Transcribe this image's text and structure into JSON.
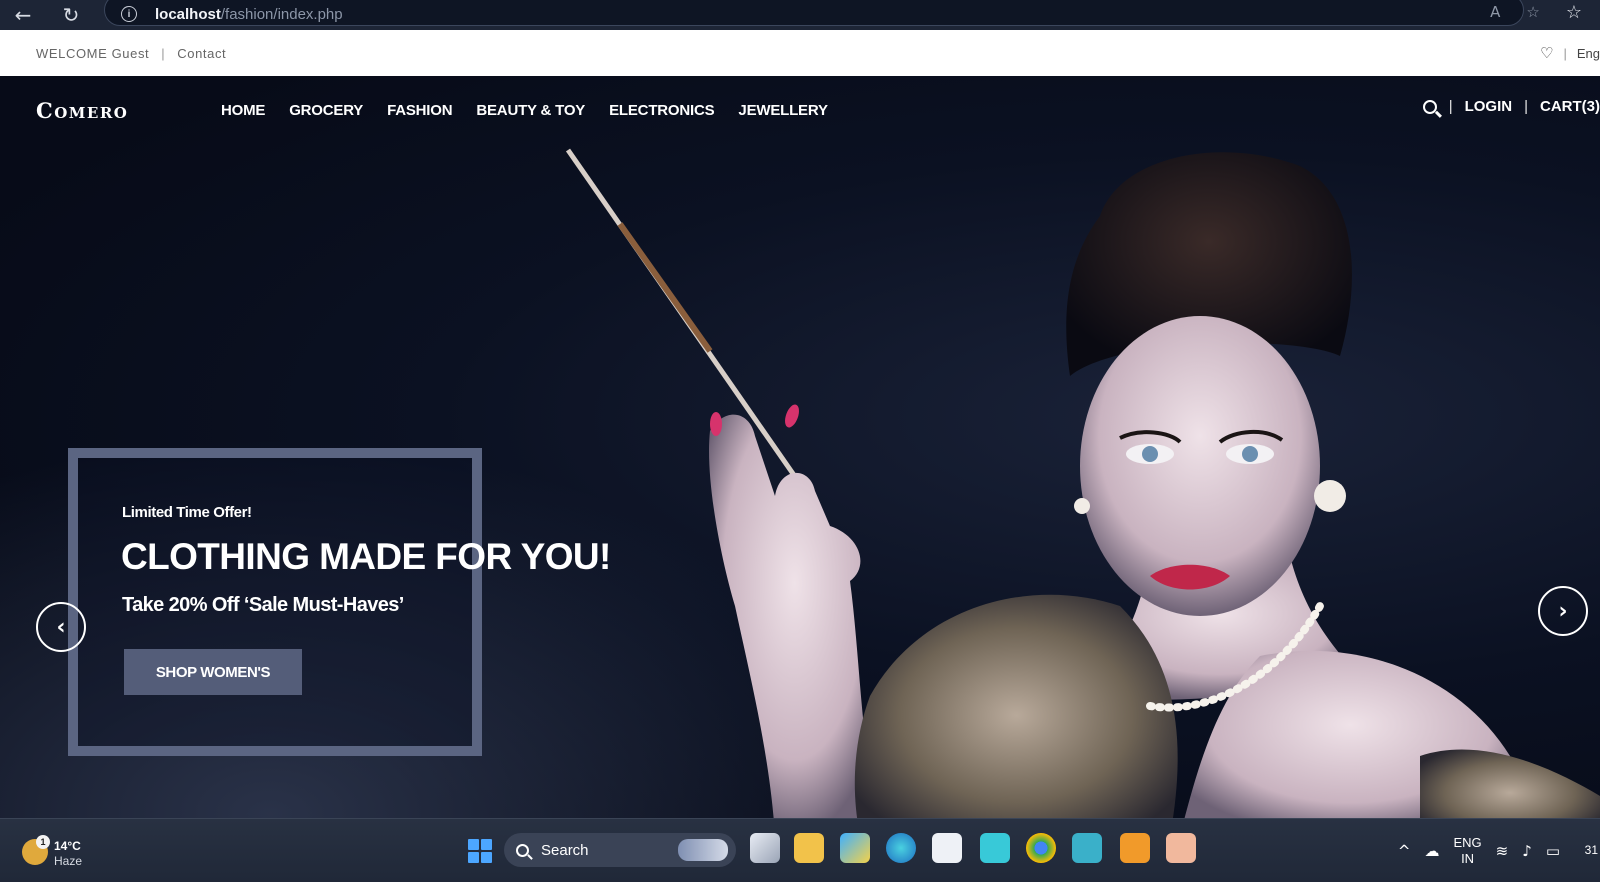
{
  "browser": {
    "url_host": "localhost",
    "url_path": "/fashion/index.php"
  },
  "topbar": {
    "welcome": "WELCOME Guest",
    "separator": "|",
    "contact": "Contact",
    "right_sep": "|",
    "language": "Eng"
  },
  "site": {
    "logo": "Comero",
    "menu": [
      "HOME",
      "GROCERY",
      "FASHION",
      "BEAUTY & TOY",
      "ELECTRONICS",
      "JEWELLERY"
    ],
    "nav_sep": "|",
    "login": "LOGIN",
    "cart": "CART(3)"
  },
  "hero": {
    "tag": "Limited Time Offer!",
    "title": "CLOTHING MADE FOR YOU!",
    "subtitle": "Take 20% Off ‘Sale Must-Haves’",
    "button": "SHOP WOMEN'S"
  },
  "taskbar": {
    "weather_temp": "14°C",
    "weather_cond": "Haze",
    "weather_badge": "1",
    "search": "Search",
    "lang_1": "ENG",
    "lang_2": "IN",
    "clock": "31"
  },
  "colors": {
    "promo_frame": "#5b6582",
    "promo_button": "#545d79",
    "hero_bg": "#0b1122"
  },
  "icons": {
    "info": "info-icon",
    "heart": "heart-icon",
    "search": "search-icon",
    "prev": "chevron-left-icon",
    "next": "chevron-right-icon"
  }
}
